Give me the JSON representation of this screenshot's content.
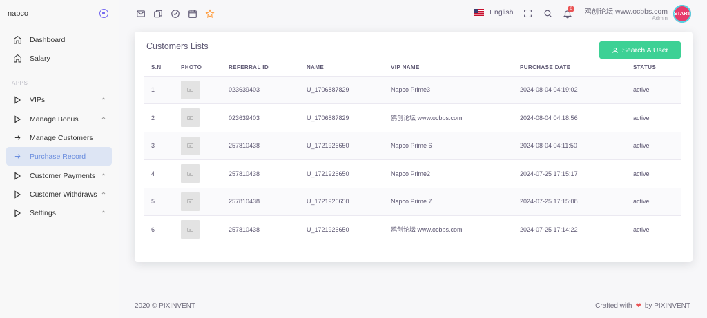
{
  "sidebar": {
    "brand": "napco",
    "section_apps": "APPS",
    "items": [
      {
        "label": "Dashboard",
        "icon": "home-icon"
      },
      {
        "label": "Salary",
        "icon": "home-icon"
      },
      {
        "label": "VIPs",
        "icon": "play-icon"
      },
      {
        "label": "Manage Bonus",
        "icon": "play-icon"
      },
      {
        "label": "Manage Customers",
        "icon": "arrow-right-icon"
      },
      {
        "label": "Purchase Record",
        "icon": "arrow-right-icon",
        "active": true
      },
      {
        "label": "Customer Payments",
        "icon": "play-icon"
      },
      {
        "label": "Customer Withdraws",
        "icon": "play-icon"
      },
      {
        "label": "Settings",
        "icon": "play-icon"
      }
    ]
  },
  "topbar": {
    "language": "English",
    "notification_count": "6",
    "user_name": "鸥创论坛 www.ocbbs.com",
    "user_role": "Admin",
    "avatar_text": "START"
  },
  "card": {
    "title": "Customers Lists",
    "search_button": "Search A User",
    "columns": [
      "S.N",
      "PHOTO",
      "REFERRAL ID",
      "NAME",
      "VIP NAME",
      "PURCHASE DATE",
      "STATUS"
    ],
    "rows": [
      {
        "sn": "1",
        "referral_id": "023639403",
        "name": "U_1706887829",
        "vip_name": "Napco Prime3",
        "purchase_date": "2024-08-04 04:19:02",
        "status": "active"
      },
      {
        "sn": "2",
        "referral_id": "023639403",
        "name": "U_1706887829",
        "vip_name": "鸥创论坛 www.ocbbs.com",
        "purchase_date": "2024-08-04 04:18:56",
        "status": "active"
      },
      {
        "sn": "3",
        "referral_id": "257810438",
        "name": "U_1721926650",
        "vip_name": "Napco Prime 6",
        "purchase_date": "2024-08-04 04:11:50",
        "status": "active"
      },
      {
        "sn": "4",
        "referral_id": "257810438",
        "name": "U_1721926650",
        "vip_name": "Napco Prime2",
        "purchase_date": "2024-07-25 17:15:17",
        "status": "active"
      },
      {
        "sn": "5",
        "referral_id": "257810438",
        "name": "U_1721926650",
        "vip_name": "Napco Prime 7",
        "purchase_date": "2024-07-25 17:15:08",
        "status": "active"
      },
      {
        "sn": "6",
        "referral_id": "257810438",
        "name": "U_1721926650",
        "vip_name": "鸥创论坛 www.ocbbs.com",
        "purchase_date": "2024-07-25 17:14:22",
        "status": "active"
      }
    ]
  },
  "footer": {
    "copyright": "2020 © PIXINVENT",
    "crafted_prefix": "Crafted with",
    "crafted_suffix": "by PIXINVENT"
  },
  "colors": {
    "accent": "#7367f0",
    "success": "#3dd195",
    "active_nav_bg": "#dde5f4",
    "danger": "#ea5455"
  }
}
